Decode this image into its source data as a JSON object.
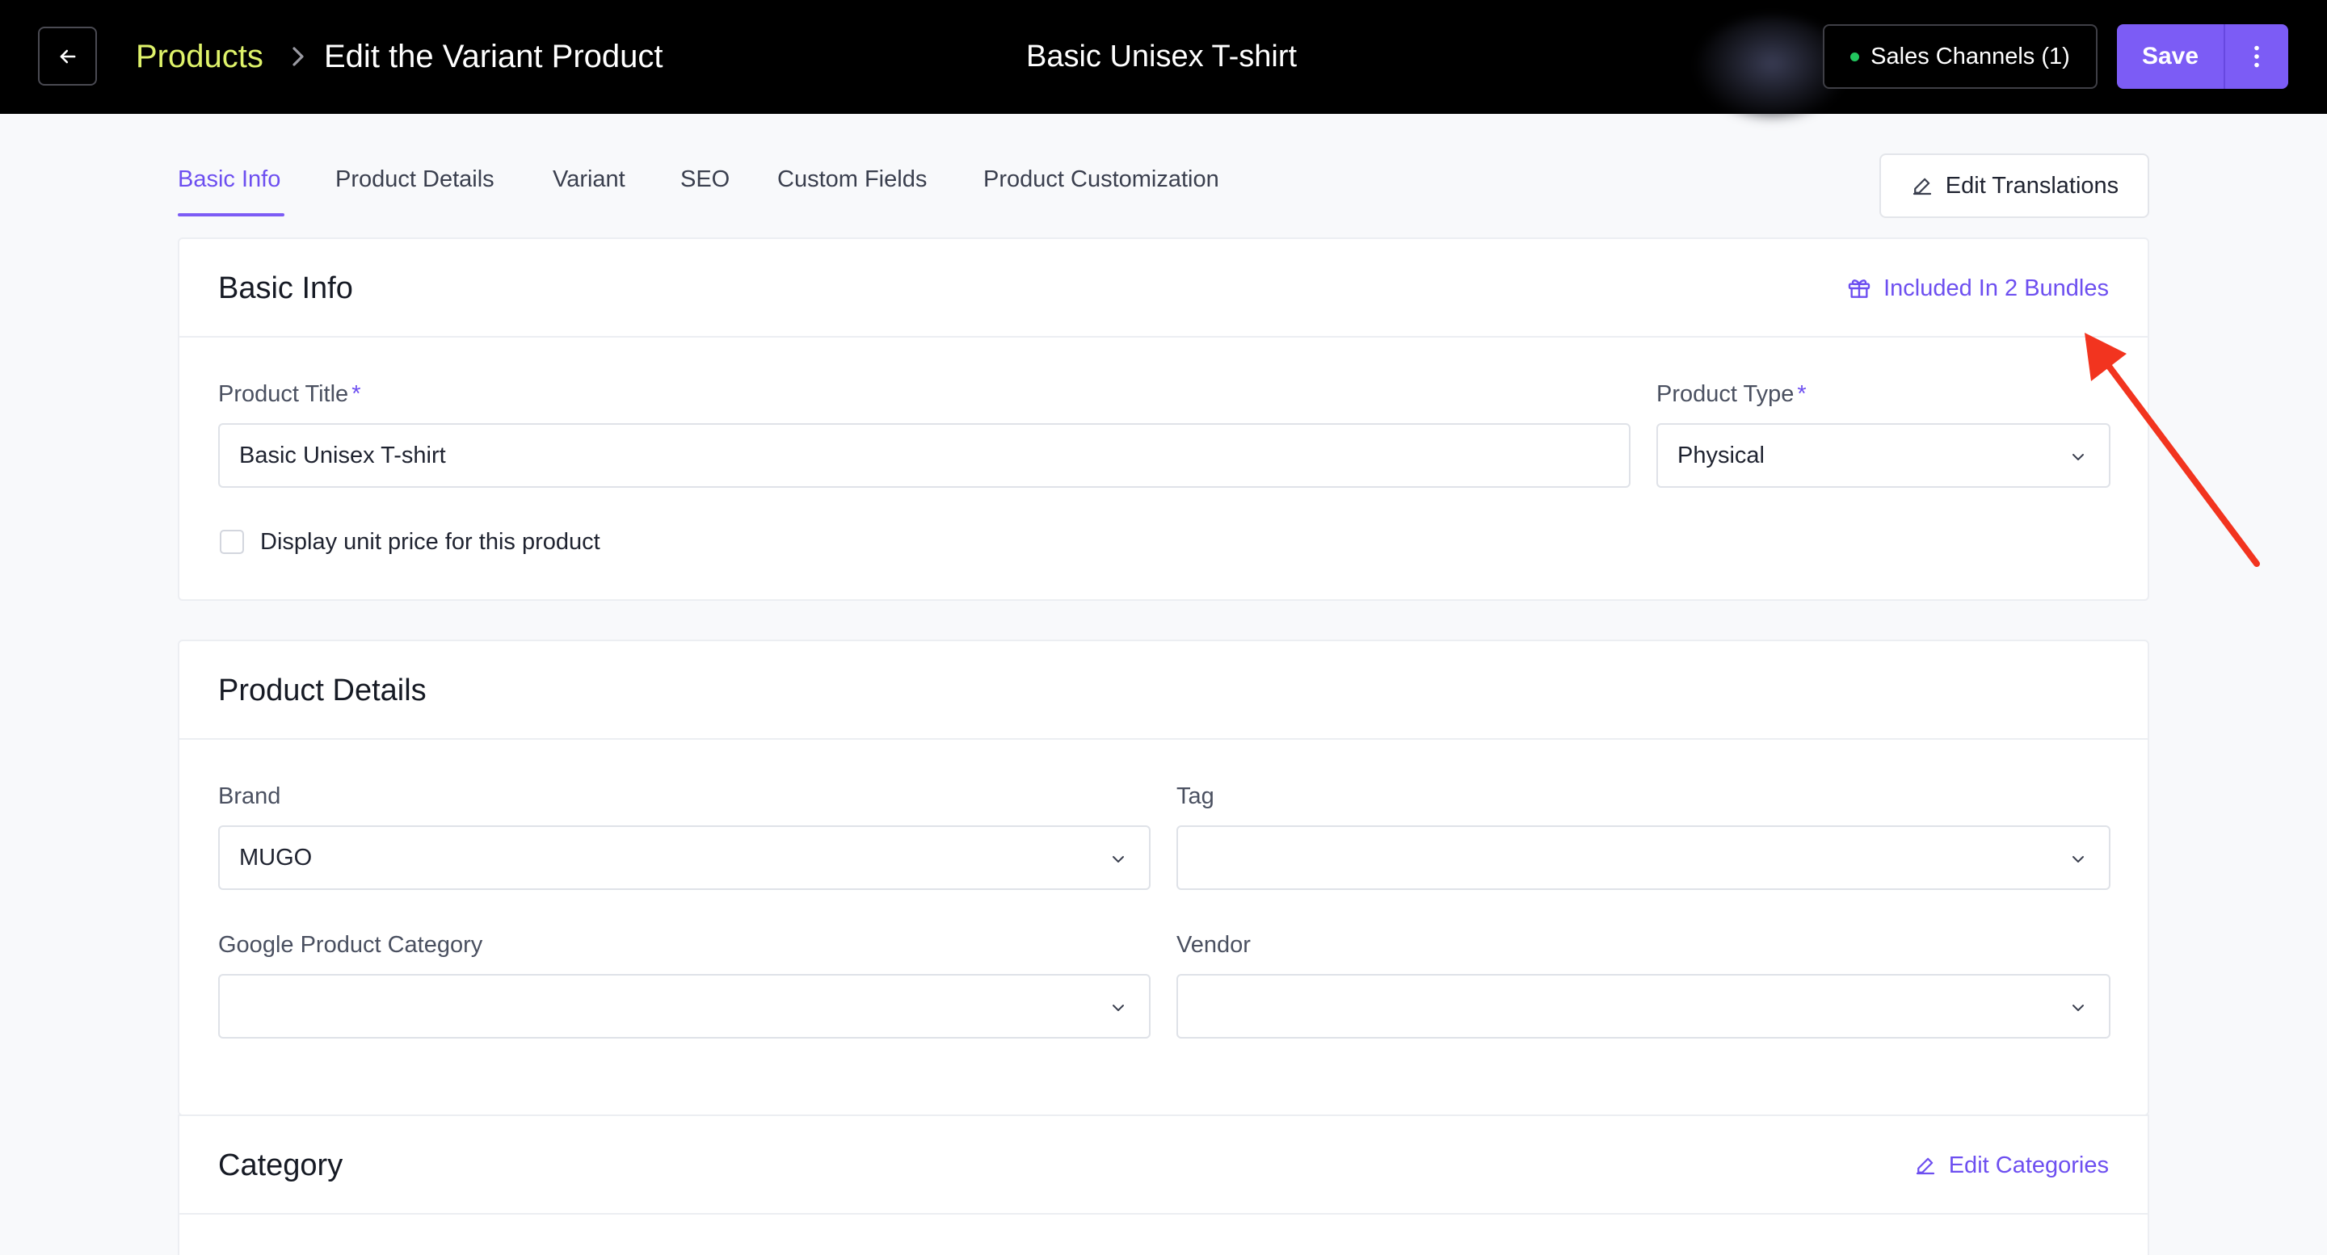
{
  "header": {
    "breadcrumb_root": "Products",
    "breadcrumb_current": "Edit the Variant Product",
    "center_title": "Basic Unisex T-shirt",
    "sales_channels_label": "Sales Channels (1)",
    "save_label": "Save"
  },
  "tabs": [
    {
      "label": "Basic Info",
      "active": true
    },
    {
      "label": "Product Details",
      "active": false
    },
    {
      "label": "Variant",
      "active": false
    },
    {
      "label": "SEO",
      "active": false
    },
    {
      "label": "Custom Fields",
      "active": false
    },
    {
      "label": "Product Customization",
      "active": false
    }
  ],
  "edit_translations_label": "Edit Translations",
  "basic_info": {
    "title": "Basic Info",
    "bundles_link": "Included In 2 Bundles",
    "product_title_label": "Product Title",
    "required_mark": "*",
    "product_title_value": "Basic Unisex T-shirt",
    "product_type_label": "Product Type",
    "product_type_value": "Physical",
    "unit_price_checkbox_label": "Display unit price for this product",
    "unit_price_checked": false
  },
  "product_details": {
    "title": "Product Details",
    "brand_label": "Brand",
    "brand_value": "MUGO",
    "tag_label": "Tag",
    "tag_value": "",
    "google_category_label": "Google Product Category",
    "google_category_value": "",
    "vendor_label": "Vendor",
    "vendor_value": ""
  },
  "category": {
    "title": "Category",
    "edit_link": "Edit Categories"
  },
  "colors": {
    "accent": "#7c5cf5",
    "breadcrumb_root": "#dff36a",
    "status_dot": "#22c55e",
    "annotation_arrow": "#f2341f"
  },
  "icons": [
    "back-arrow-icon",
    "chevron-right-icon",
    "status-dot-icon",
    "more-vertical-icon",
    "pencil-icon",
    "gift-icon",
    "chevron-down-icon"
  ]
}
